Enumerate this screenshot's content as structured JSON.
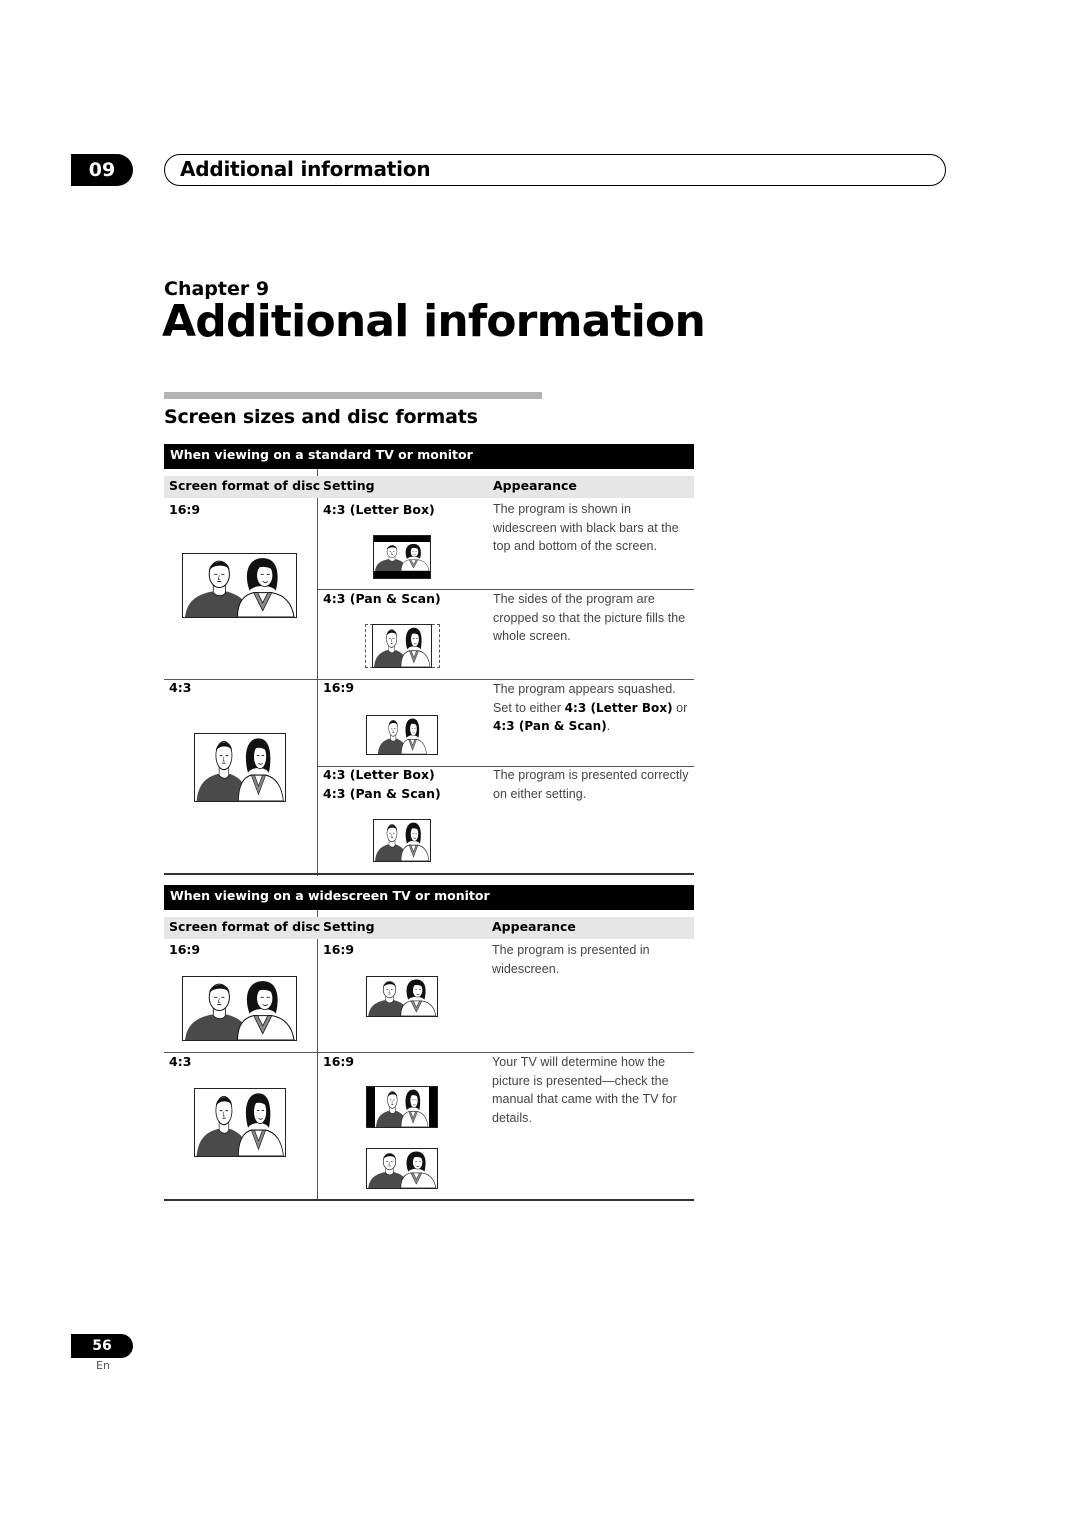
{
  "header": {
    "chapter_number": "09",
    "chapter_title": "Additional information"
  },
  "chapter": {
    "label": "Chapter 9",
    "title": "Additional information"
  },
  "section": {
    "title": "Screen sizes and disc formats"
  },
  "standard_table": {
    "heading": "When viewing on a standard TV or monitor",
    "columns": [
      "Screen format of disc",
      "Setting",
      "Appearance"
    ],
    "rows": [
      {
        "disc_format": "16:9",
        "settings": [
          {
            "setting": "4:3 (Letter Box)",
            "illustration": "letterbox-tv-icon",
            "appearance": "The program is shown in widescreen with black bars at the top and bottom of the screen."
          },
          {
            "setting": "4:3 (Pan & Scan)",
            "illustration": "pan-scan-tv-icon",
            "appearance": "The sides of the program are cropped so that the picture fills the whole screen."
          }
        ]
      },
      {
        "disc_format": "4:3",
        "settings": [
          {
            "setting": "16:9",
            "illustration": "squashed-tv-icon",
            "appearance_parts": [
              "The program appears squashed. Set to either ",
              "4:3 (Letter Box)",
              " or ",
              "4:3 (Pan & Scan)",
              "."
            ]
          },
          {
            "setting": "4:3 (Letter Box)",
            "setting_2": "4:3 (Pan & Scan)",
            "illustration": "standard-tv-icon",
            "appearance": "The program is presented correctly on either setting."
          }
        ]
      }
    ]
  },
  "widescreen_table": {
    "heading": "When viewing on a widescreen TV or monitor",
    "columns": [
      "Screen format of disc",
      "Setting",
      "Appearance"
    ],
    "rows": [
      {
        "disc_format": "16:9",
        "setting": "16:9",
        "appearance": "The program is presented in widescreen."
      },
      {
        "disc_format": "4:3",
        "setting": "16:9",
        "appearance": "Your TV will determine how the picture is presented—check the manual that came with the TV for details."
      }
    ]
  },
  "footer": {
    "page_number": "56",
    "language": "En"
  }
}
